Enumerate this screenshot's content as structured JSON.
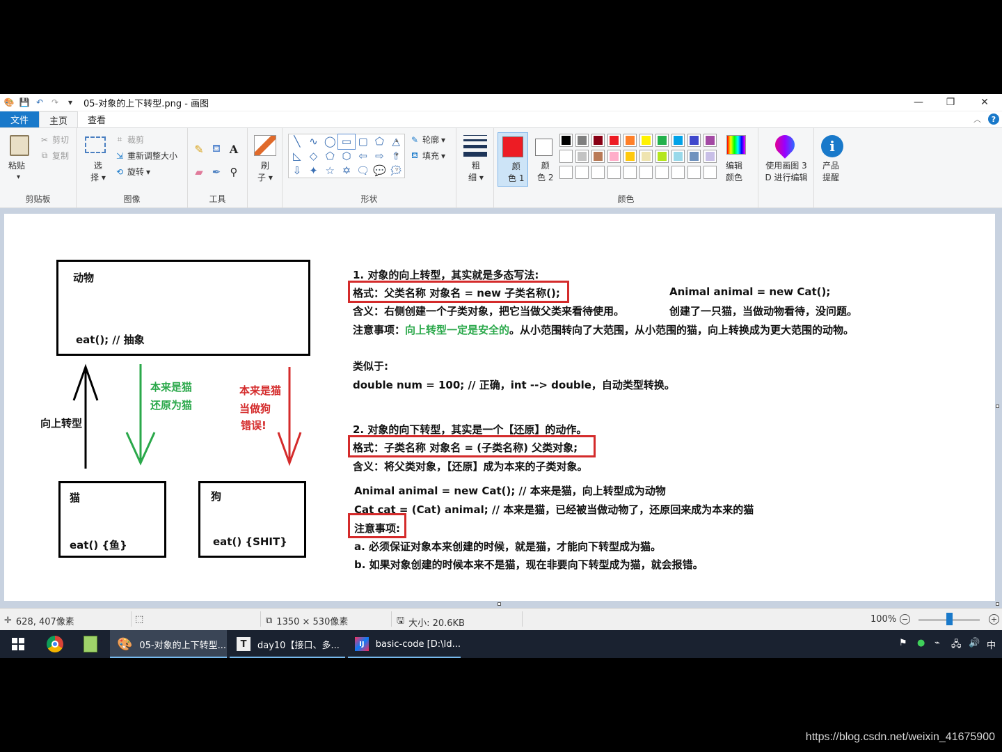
{
  "window": {
    "title": "05-对象的上下转型.png - 画图",
    "controls": {
      "minimize": "—",
      "restore": "❐",
      "close": "✕"
    }
  },
  "tabs": [
    "文件",
    "主页",
    "查看"
  ],
  "ribbon": {
    "clipboard": {
      "paste": "粘贴",
      "cut": "剪切",
      "copy": "复制",
      "label": "剪贴板"
    },
    "image": {
      "select_1": "选",
      "select_2": "择",
      "crop": "裁剪",
      "resize": "重新调整大小",
      "rotate": "旋转",
      "label": "图像"
    },
    "tools": {
      "label": "工具"
    },
    "brushes": {
      "label_1": "刷",
      "label_2": "子"
    },
    "shapes": {
      "outline": "轮廓",
      "fill": "填充",
      "label": "形状"
    },
    "size": {
      "label_1": "粗",
      "label_2": "细"
    },
    "color1": {
      "label_1": "颜",
      "label_2": "色 1",
      "value": "#ed1c24"
    },
    "color2": {
      "label_1": "颜",
      "label_2": "色 2",
      "value": "#ffffff"
    },
    "colors": {
      "label": "颜色",
      "row1": [
        "#000000",
        "#7f7f7f",
        "#880015",
        "#ed1c24",
        "#ff7f27",
        "#fff200",
        "#22b14c",
        "#00a2e8",
        "#3f48cc",
        "#a349a4"
      ],
      "row2": [
        "#ffffff",
        "#c3c3c3",
        "#b97a57",
        "#ffaec9",
        "#ffc90e",
        "#efe4b0",
        "#b5e61d",
        "#99d9ea",
        "#7092be",
        "#c8bfe7"
      ]
    },
    "edit_colors": {
      "label_1": "编辑",
      "label_2": "颜色"
    },
    "paint3d": {
      "label_1": "使用画图 3",
      "label_2": "D 进行编辑"
    },
    "product": {
      "label_1": "产品",
      "label_2": "提醒"
    }
  },
  "canvas": {
    "animal_title": "动物",
    "animal_method": "eat(); // 抽象",
    "upcast_label": "向上转型",
    "green_note_1": "本来是猫",
    "green_note_2": "还原为猫",
    "red_note_1": "本来是猫",
    "red_note_2": "当做狗",
    "red_note_3": "错误!",
    "cat_title": "猫",
    "cat_method": "eat() {鱼}",
    "dog_title": "狗",
    "dog_method": "eat() {SHIT}",
    "lines": {
      "l1": "1. 对象的向上转型，其实就是多态写法:",
      "l2": "格式：父类名称 对象名 = new 子类名称();",
      "l2b": "Animal animal = new Cat();",
      "l3": "含义：右侧创建一个子类对象，把它当做父类来看待使用。",
      "l3b": "创建了一只猫，当做动物看待，没问题。",
      "l4a": "注意事项：",
      "l4b": "向上转型一定是安全的",
      "l4c": "。从小范围转向了大范围，从小范围的猫，向上转换成为更大范围的动物。",
      "l5": "类似于:",
      "l6": "double num = 100; // 正确，int --> double，自动类型转换。",
      "l7": "2. 对象的向下转型，其实是一个【还原】的动作。",
      "l8": "格式：子类名称 对象名 = (子类名称) 父类对象;",
      "l9": "含义：将父类对象，【还原】成为本来的子类对象。",
      "l10": "Animal animal = new Cat(); // 本来是猫，向上转型成为动物",
      "l11": "Cat cat = (Cat) animal; // 本来是猫，已经被当做动物了，还原回来成为本来的猫",
      "l12": "注意事项:",
      "l13": "a. 必须保证对象本来创建的时候，就是猫，才能向下转型成为猫。",
      "l14": "b. 如果对象创建的时候本来不是猫，现在非要向下转型成为猫，就会报错。"
    }
  },
  "status": {
    "cursor": "628, 407像素",
    "dimensions": "1350 × 530像素",
    "filesize": "大小: 20.6KB",
    "zoom": "100%",
    "zoom_fraction": 0.5
  },
  "taskbar": {
    "apps": [
      {
        "label": "05-对象的上下转型..."
      },
      {
        "label": "day10【接口、多..."
      },
      {
        "label": "basic-code [D:\\Id..."
      }
    ],
    "ime": "中"
  },
  "watermark": "https://blog.csdn.net/weixin_41675900"
}
